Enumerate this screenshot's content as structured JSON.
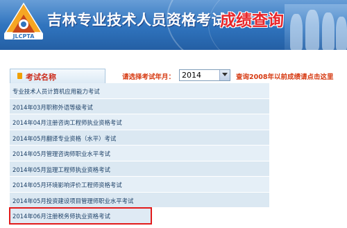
{
  "header": {
    "site_title": "吉林专业技术人员资格考试",
    "page_heading": "成绩查询",
    "logo_text": "JLCPTA"
  },
  "toolbar": {
    "tab_label": "考试名称",
    "year_label": "请选择考试年月：",
    "year_selected": "2014",
    "old_scores_link": "查询2008年以前成绩请点击这里"
  },
  "exams": [
    {
      "label": "专业技术人员计算机应用能力考试"
    },
    {
      "label": "2014年03月职称外语等级考试"
    },
    {
      "label": "2014年04月注册咨询工程师执业资格考试"
    },
    {
      "label": "2014年05月翻译专业资格（水平）考试"
    },
    {
      "label": "2014年05月管理咨询师职业水平考试"
    },
    {
      "label": "2014年05月监理工程师执业资格考试"
    },
    {
      "label": "2014年05月环境影响评价工程师资格考试"
    },
    {
      "label": "2014年05月投资建设项目管理师职业水平考试"
    },
    {
      "label": "2014年06月注册税务师执业资格考试",
      "highlighted": true
    }
  ],
  "colors": {
    "banner": "#2f73bd",
    "heading_red": "#e8262a",
    "highlight_border": "#e21b1b",
    "row_bg": "#e5eff7",
    "link_text": "#1b3f66"
  }
}
